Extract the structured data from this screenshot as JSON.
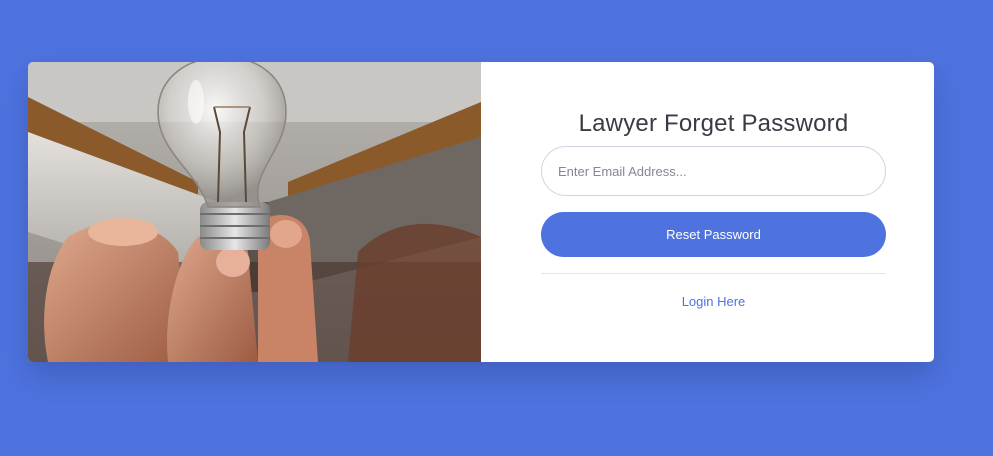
{
  "colors": {
    "page_background": "#4e73df",
    "card_background": "#ffffff",
    "accent": "#4e73df",
    "title_text": "#3a3b45",
    "link_text": "#4e73df"
  },
  "image": {
    "subject": "hand holding a light bulb in front of an open book"
  },
  "form": {
    "title": "Lawyer Forget Password",
    "email_value": "",
    "email_placeholder": "Enter Email Address...",
    "reset_button_label": "Reset Password",
    "login_link_label": "Login Here"
  }
}
